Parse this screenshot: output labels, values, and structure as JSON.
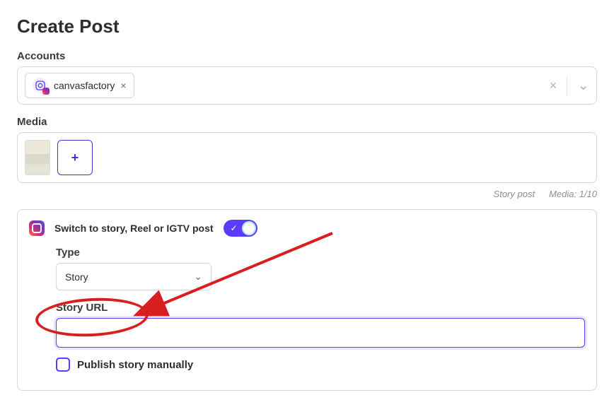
{
  "header": {
    "title": "Create Post"
  },
  "accounts": {
    "label": "Accounts",
    "chip": {
      "name": "canvasfactory",
      "remove_glyph": "×"
    },
    "clear_glyph": "×",
    "chevron_glyph": "⌄"
  },
  "media": {
    "label": "Media",
    "add_glyph": "+",
    "meta_left": "Story post",
    "meta_right": "Media: 1/10"
  },
  "panel": {
    "switch_label": "Switch to story, Reel or IGTV post",
    "toggle_on": true,
    "check_glyph": "✓",
    "type_label": "Type",
    "type_value": "Story",
    "chevron_glyph": "⌄",
    "url_label": "Story URL",
    "url_value": "",
    "publish_manually": "Publish story manually"
  },
  "annotation": {
    "arrow_color": "#d81f1f"
  }
}
